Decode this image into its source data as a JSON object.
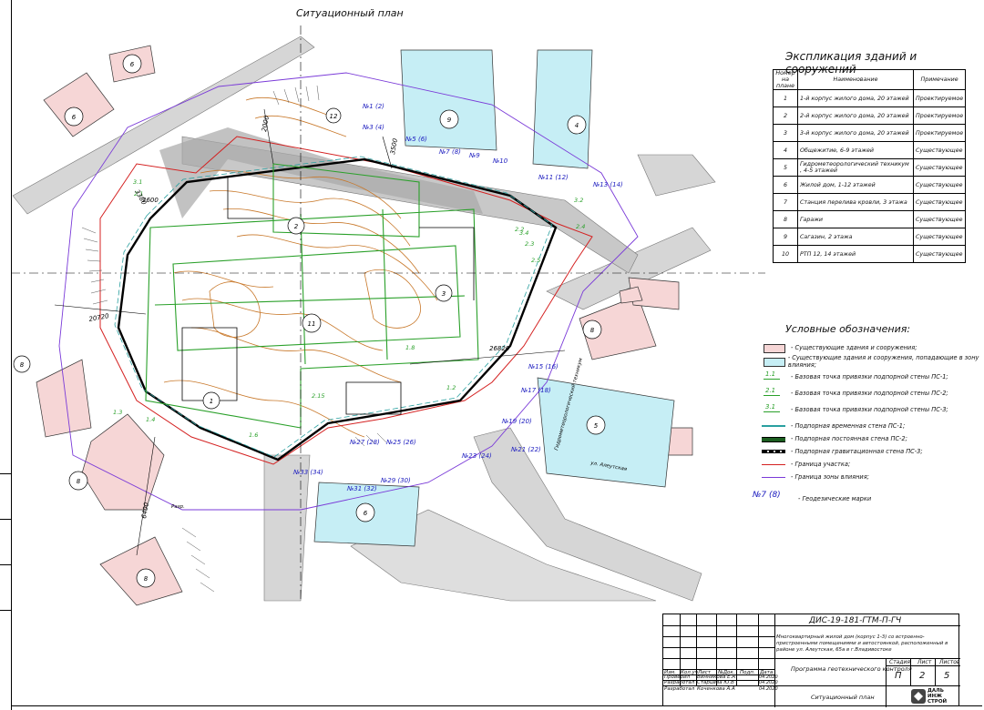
{
  "sheet_title": "Ситуационный план",
  "explication": {
    "title": "Экспликация зданий и сооружений",
    "headers": [
      "Номер на плане",
      "Наименование",
      "Примечание"
    ],
    "rows": [
      {
        "num": "1",
        "name": "1-й корпус жилого дома, 20 этажей",
        "note": "Проектируемое"
      },
      {
        "num": "2",
        "name": "2-й корпус жилого дома, 20 этажей",
        "note": "Проектируемое"
      },
      {
        "num": "3",
        "name": "3-й корпус жилого дома, 20 этажей",
        "note": "Проектируемое"
      },
      {
        "num": "4",
        "name": "Общежитие, 6-9 этажей",
        "note": "Существующее"
      },
      {
        "num": "5",
        "name": "Гидрометеорологический техникум , 4-5 этажей",
        "note": "Существующее"
      },
      {
        "num": "6",
        "name": "Жилой дом, 1-12 этажей",
        "note": "Существующее"
      },
      {
        "num": "7",
        "name": "Станция перелива кровли, 3 этажа",
        "note": "Существующее"
      },
      {
        "num": "8",
        "name": "Гаражи",
        "note": "Существующее"
      },
      {
        "num": "9",
        "name": "Сагазин, 2 этажа",
        "note": "Существующее"
      },
      {
        "num": "10",
        "name": "РТП 12, 14 этажей",
        "note": "Существующее"
      }
    ]
  },
  "legend": {
    "title": "Условные обозначения:",
    "items": [
      {
        "label": "- Существующие здания и сооружения;",
        "symbol": "",
        "color": "#f6d6d6"
      },
      {
        "label": "- Существующие здания и сооружения, попадающие в зону влияния;",
        "symbol": "",
        "color": "#c6eef5"
      },
      {
        "label": "- Базовая точка привязки подпорной стены ПС-1;",
        "symbol": "1.1",
        "color": "#2aa02a"
      },
      {
        "label": "- Базовая точка привязки подпорной стены ПС-2;",
        "symbol": "2.1",
        "color": "#2aa02a"
      },
      {
        "label": "- Базовая точка привязки подпорной стены ПС-3;",
        "symbol": "3.1",
        "color": "#2aa02a"
      },
      {
        "label": "- Подпорная временная стена ПС-1;",
        "symbol": "",
        "color": "#2aa0a0"
      },
      {
        "label": "- Подпорная постоянная стена ПС-2;",
        "symbol": "",
        "color": "#000000"
      },
      {
        "label": "- Подпорная гравитационная стена ПС-3;",
        "symbol": "",
        "color": "#000000"
      },
      {
        "label": "- Граница участка;",
        "symbol": "",
        "color": "#d42020"
      },
      {
        "label": "- Граница зоны влияния;",
        "symbol": "",
        "color": "#7a3ad8"
      },
      {
        "label": "- Геодезические марки",
        "symbol": "№7 (8)",
        "color": "#2020c0"
      }
    ]
  },
  "plan_labels": {
    "circles": [
      "1",
      "2",
      "3",
      "11",
      "6",
      "6",
      "6",
      "8",
      "8",
      "8",
      "8",
      "9",
      "4",
      "5",
      "12"
    ],
    "marks": [
      "№1 (2)",
      "№3 (4)",
      "№5 (6)",
      "№7 (8)",
      "№9",
      "№10",
      "№11 (12)",
      "№13 (14)",
      "№15 (16)",
      "№17 (18)",
      "№19 (20)",
      "№21 (22)",
      "№23 (24)",
      "№25 (26)",
      "№27 (28)",
      "№29 (30)",
      "№31 (32)",
      "№33 (34)"
    ],
    "points": [
      "3.1",
      "2.1",
      "2.2",
      "2.3",
      "2.4",
      "2.5",
      "3.4",
      "1.8",
      "1.2",
      "2.15",
      "1.6",
      "3.2",
      "1.4",
      "1.3"
    ],
    "dims": [
      "2000",
      "3500",
      "2600",
      "20720",
      "26820",
      "3380",
      "6400"
    ],
    "misc": [
      "Разр.",
      "Гидрометеорологический техникум",
      "ул. Алеутская"
    ]
  },
  "stamp": {
    "code": "ДИС-19-181-ГТМ-П-ГЧ",
    "description": "Многоквартирный жилой дом (корпус 1-3) со встроенно-пристроенными помещениями и автостоянкой, расположенный в районе ул. Алеутская, 65а в г.Владивостоке",
    "doc_name": "Программа геотехнического контроля",
    "sheet_name": "Ситуационный план",
    "col_headers": [
      "Изм.",
      "Кол.уч",
      "Лист",
      "№Док.",
      "Подп.",
      "Дата"
    ],
    "people": [
      {
        "role": "Проверил",
        "name": "Винникова Е.А",
        "date": "04.2020"
      },
      {
        "role": "Разработал",
        "name": "Старцева Ю.В",
        "date": "04.2020"
      },
      {
        "role": "Разработал",
        "name": "Коченкова А.А",
        "date": "04.2020"
      }
    ],
    "stage_header": "Стадия",
    "stage": "П",
    "sheet_header": "Лист",
    "sheet": "2",
    "sheets_header": "Листов",
    "sheets": "5",
    "logo_text": "ДАЛЬ ИНЖ СТРОЙ"
  }
}
